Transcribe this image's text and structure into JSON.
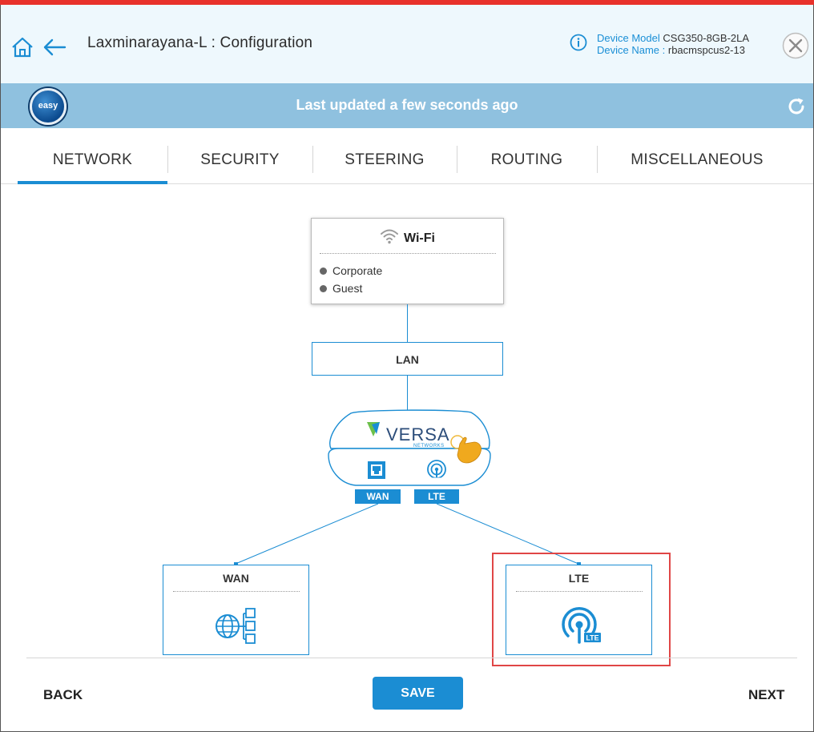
{
  "header": {
    "title": "Laxminarayana-L : Configuration",
    "device_model_label": "Device Model",
    "device_model_value": "CSG350-8GB-2LA",
    "device_name_label": "Device Name :",
    "device_name_value": "rbacmspcus2-13"
  },
  "status_bar": {
    "badge": "easy",
    "text": "Last updated a few seconds ago"
  },
  "tabs": [
    {
      "label": "NETWORK",
      "active": true
    },
    {
      "label": "SECURITY",
      "active": false
    },
    {
      "label": "STEERING",
      "active": false
    },
    {
      "label": "ROUTING",
      "active": false
    },
    {
      "label": "MISCELLANEOUS",
      "active": false
    }
  ],
  "diagram": {
    "wifi": {
      "title": "Wi-Fi",
      "items": [
        "Corporate",
        "Guest"
      ]
    },
    "lan": {
      "title": "LAN"
    },
    "device": {
      "brand": "VERSA",
      "sub_brand": "NETWORKS",
      "ports": [
        "WAN",
        "LTE"
      ]
    },
    "wan_node": {
      "title": "WAN",
      "icon": "globe-network-icon"
    },
    "lte_node": {
      "title": "LTE",
      "icon": "lte-antenna-icon",
      "badge": "LTE"
    }
  },
  "footer": {
    "back_label": "BACK",
    "save_label": "SAVE",
    "next_label": "NEXT"
  },
  "colors": {
    "accent": "#1b8dd3",
    "top_stripe": "#e8322b",
    "status_bar": "#8fc1df",
    "highlight": "#e04646"
  }
}
